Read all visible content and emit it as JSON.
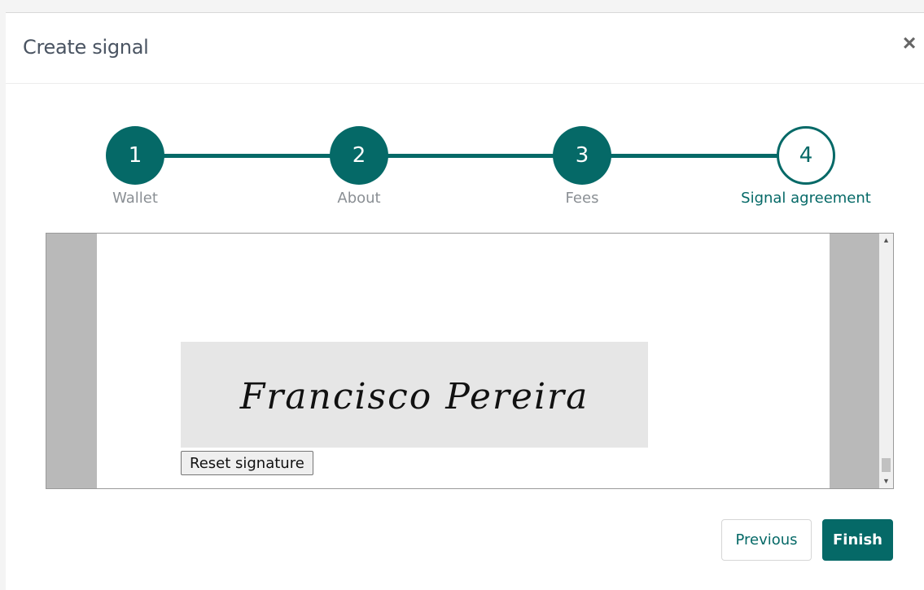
{
  "modal": {
    "title": "Create signal",
    "close_symbol": "×"
  },
  "stepper": {
    "steps": [
      {
        "number": "1",
        "label": "Wallet",
        "state": "done"
      },
      {
        "number": "2",
        "label": "About",
        "state": "done"
      },
      {
        "number": "3",
        "label": "Fees",
        "state": "done"
      },
      {
        "number": "4",
        "label": "Signal agreement",
        "state": "active"
      }
    ]
  },
  "document": {
    "signature_text": "Francisco Pereira",
    "reset_label": "Reset signature",
    "scroll_up_symbol": "▲",
    "scroll_down_symbol": "▼"
  },
  "footer": {
    "previous_label": "Previous",
    "finish_label": "Finish"
  },
  "colors": {
    "accent": "#056967",
    "muted_label": "#8a8f94"
  }
}
